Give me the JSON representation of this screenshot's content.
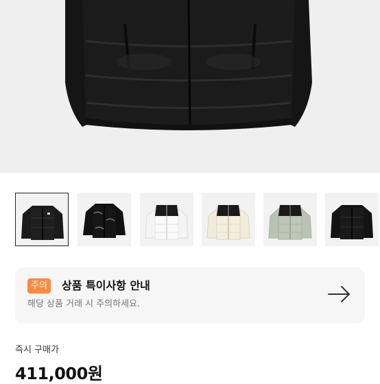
{
  "product": {
    "hero_image": "black-puffer-jacket-photo",
    "thumbnails": [
      {
        "icon": "black-puffer-thumbnail",
        "selected": true
      },
      {
        "icon": "glossy-black-puffer-thumbnail",
        "selected": false
      },
      {
        "icon": "white-black-puffer-thumbnail",
        "selected": false
      },
      {
        "icon": "cream-black-puffer-thumbnail",
        "selected": false
      },
      {
        "icon": "sage-black-puffer-thumbnail",
        "selected": false
      },
      {
        "icon": "black-puffer-thumbnail",
        "selected": false
      }
    ]
  },
  "notice": {
    "badge": "주의",
    "title": "상품 특이사항 안내",
    "subtitle": "해당 상품 거래 시 주의하세요.",
    "arrow_icon": "arrow-right-icon"
  },
  "price": {
    "label": "즉시 구매가",
    "value": "411,000원"
  },
  "colors": {
    "badge": "#ff8a3d",
    "notice_bg": "#f6f6f6",
    "thumb_bg": "#f2f2f2"
  }
}
